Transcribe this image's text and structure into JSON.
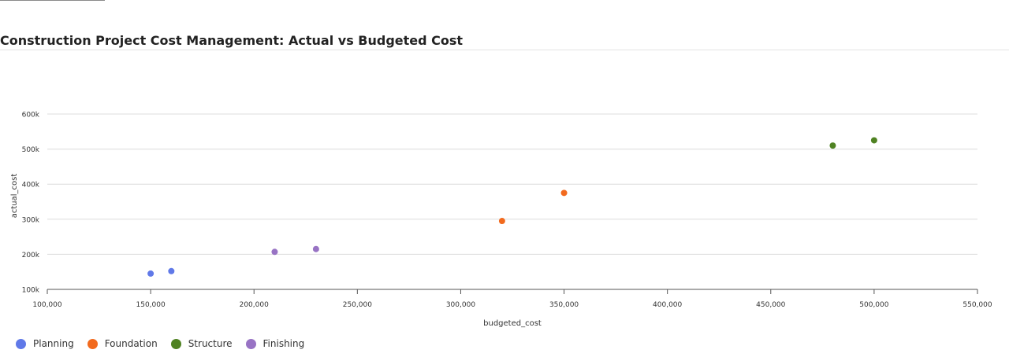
{
  "page": {
    "title": "Construction Project Cost Management: Actual vs Budgeted Cost"
  },
  "chart_data": {
    "type": "scatter",
    "title": "Construction Project Cost Management: Actual vs Budgeted Cost",
    "xlabel": "budgeted_cost",
    "ylabel": "actual_cost",
    "xlim": [
      100000,
      550000
    ],
    "ylim": [
      100000,
      600000
    ],
    "x_ticks": [
      100000,
      150000,
      200000,
      250000,
      300000,
      350000,
      400000,
      450000,
      500000,
      550000
    ],
    "x_tick_labels": [
      "100,000",
      "150,000",
      "200,000",
      "250,000",
      "300,000",
      "350,000",
      "400,000",
      "450,000",
      "500,000",
      "550,000"
    ],
    "y_ticks": [
      100000,
      200000,
      300000,
      400000,
      500000,
      600000
    ],
    "y_tick_labels": [
      "100k",
      "200k",
      "300k",
      "400k",
      "500k",
      "600k"
    ],
    "grid": true,
    "legend_position": "bottom-left",
    "series": [
      {
        "name": "Planning",
        "color": "#6079e8",
        "points": [
          {
            "x": 150000,
            "y": 145000
          },
          {
            "x": 160000,
            "y": 152000
          }
        ]
      },
      {
        "name": "Foundation",
        "color": "#f26a1e",
        "points": [
          {
            "x": 320000,
            "y": 295000
          },
          {
            "x": 350000,
            "y": 375000
          }
        ]
      },
      {
        "name": "Structure",
        "color": "#4f8222",
        "points": [
          {
            "x": 480000,
            "y": 510000
          },
          {
            "x": 500000,
            "y": 525000
          }
        ]
      },
      {
        "name": "Finishing",
        "color": "#9873c4",
        "points": [
          {
            "x": 210000,
            "y": 207000
          },
          {
            "x": 230000,
            "y": 215000
          }
        ]
      }
    ]
  }
}
